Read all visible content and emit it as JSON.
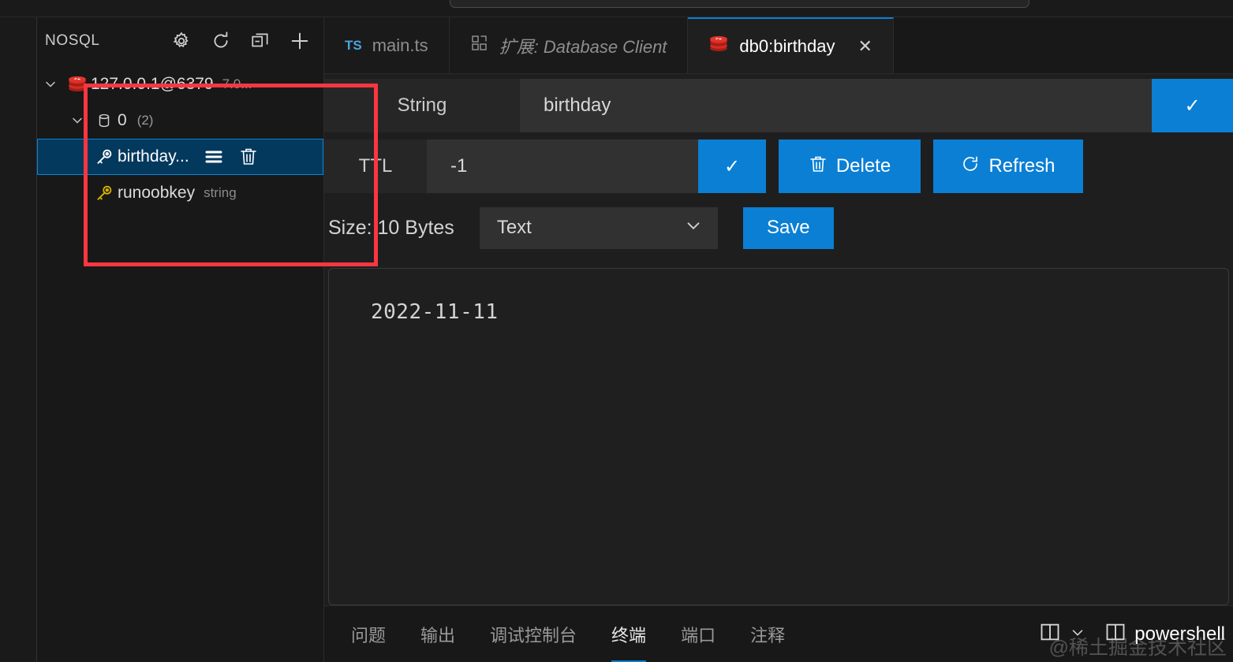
{
  "sidebar": {
    "title": "NOSQL",
    "actions": [
      {
        "name": "settings-icon",
        "label": "Settings"
      },
      {
        "name": "refresh-icon",
        "label": "Refresh"
      },
      {
        "name": "collapse-all-icon",
        "label": "Collapse All"
      },
      {
        "name": "add-icon",
        "label": "Add Connection"
      }
    ],
    "tree": [
      {
        "label": "127.0.0.1@6379",
        "description": "7.0...",
        "icon": "redis-icon",
        "expanded": true,
        "level": 0
      },
      {
        "label": "0",
        "count": "(2)",
        "icon": "database-icon",
        "expanded": true,
        "level": 1
      },
      {
        "label": "birthday...",
        "icon": "key-icon",
        "selected": true,
        "level": 2,
        "actions": [
          "list-icon",
          "trash-icon"
        ]
      },
      {
        "label": "runoobkey",
        "description": "string",
        "icon": "key-icon",
        "selected": false,
        "level": 2
      }
    ]
  },
  "tabs": [
    {
      "label": "main.ts",
      "icon": "typescript-icon",
      "icon_text": "TS",
      "active": false,
      "italic": false
    },
    {
      "label": "扩展: Database Client",
      "icon": "extensions-icon",
      "active": false,
      "italic": true
    },
    {
      "label": "db0:birthday",
      "icon": "redis-icon",
      "active": true,
      "italic": false,
      "close": "✕"
    }
  ],
  "editor": {
    "type_label": "String",
    "key_value": "birthday",
    "key_confirm": "✓",
    "ttl_label": "TTL",
    "ttl_value": "-1",
    "ttl_confirm": "✓",
    "delete_label": "Delete",
    "refresh_label": "Refresh",
    "size_label": "Size: 10 Bytes",
    "view_mode": "Text",
    "save_label": "Save",
    "value": "2022-11-11"
  },
  "panel": {
    "tabs": [
      {
        "label": "问题",
        "active": false
      },
      {
        "label": "输出",
        "active": false
      },
      {
        "label": "调试控制台",
        "active": false
      },
      {
        "label": "终端",
        "active": true
      },
      {
        "label": "端口",
        "active": false
      },
      {
        "label": "注释",
        "active": false
      }
    ],
    "split_icon": "split-panel-icon",
    "chevron": "⌄",
    "terminal_icon": "split-panel-icon",
    "terminal_name": "powershell"
  },
  "watermark": "@稀土掘金技术社区",
  "colors": {
    "accent_blue": "#0a7fd4",
    "selection_blue": "#04395e",
    "annotation_red": "#fb3640",
    "redis_red": "#d62b23",
    "key_yellow": "#d7b000",
    "editor_bg": "#1e1e1e",
    "sidebar_bg": "#181818"
  }
}
